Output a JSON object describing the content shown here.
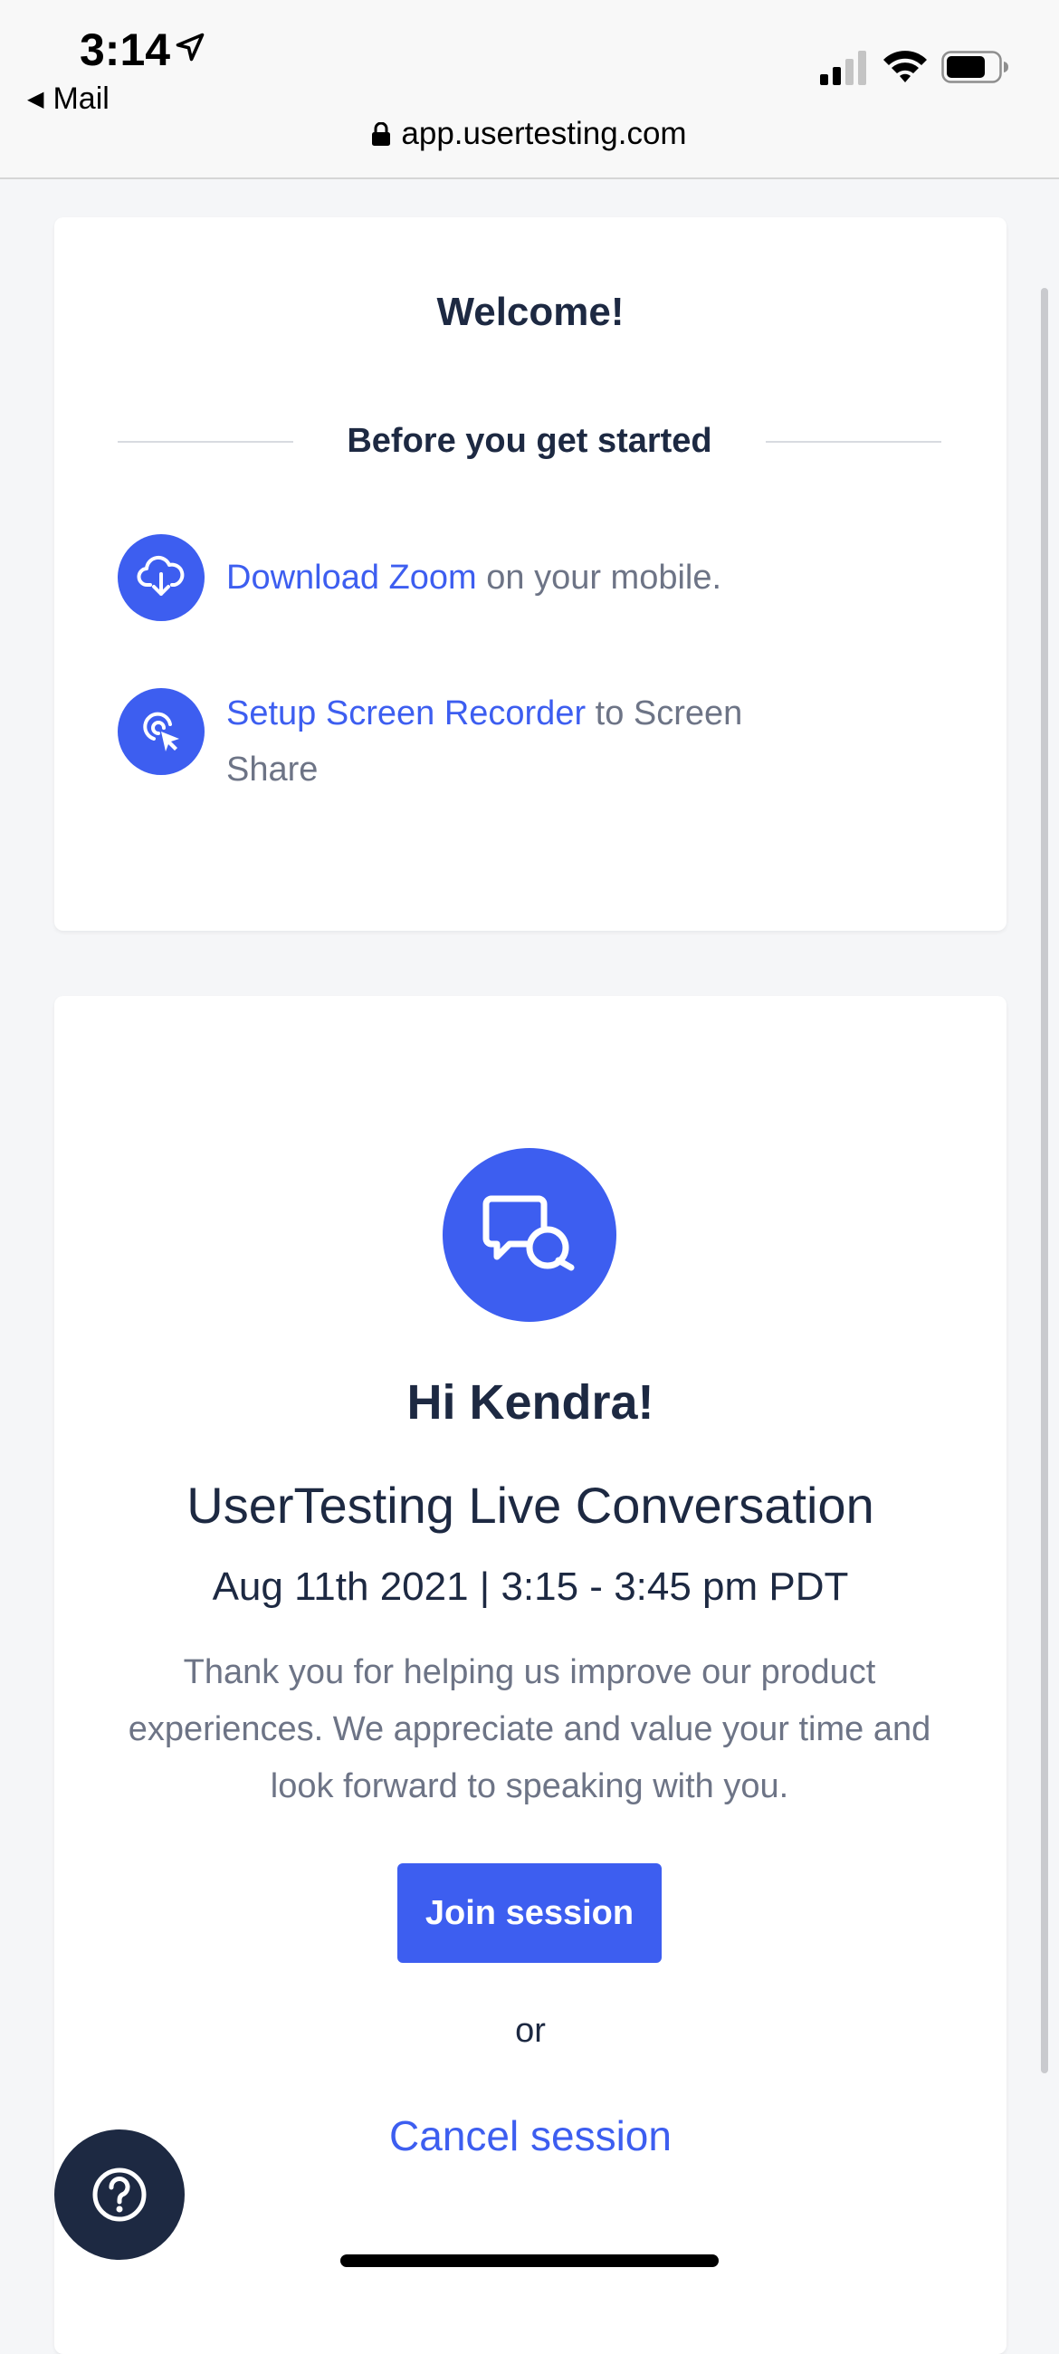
{
  "status_bar": {
    "time": "3:14",
    "back_label": "Mail",
    "url": "app.usertesting.com"
  },
  "getting_started": {
    "title": "Welcome!",
    "section_heading": "Before you get started",
    "tasks": [
      {
        "link_text": "Download Zoom",
        "rest_text": " on your mobile.",
        "icon": "cloud-download-icon"
      },
      {
        "link_text": "Setup Screen Recorder",
        "rest_text": " to Screen Share",
        "icon": "cursor-click-icon"
      }
    ]
  },
  "session": {
    "icon": "chat-bubbles-icon",
    "greeting": "Hi Kendra!",
    "title": "UserTesting Live Conversation",
    "date_time": "Aug 11th 2021 | 3:15 - 3:45 pm PDT",
    "description": "Thank you for helping us improve our product experiences. We appreciate and value your time and look forward to speaking with you.",
    "join_label": "Join session",
    "or_label": "or",
    "cancel_label": "Cancel session"
  },
  "help": {
    "icon": "question-mark-icon"
  },
  "colors": {
    "accent": "#3d5ef0",
    "heading": "#1d2942",
    "body_text": "#6d7486",
    "page_bg": "#f5f6f8"
  }
}
